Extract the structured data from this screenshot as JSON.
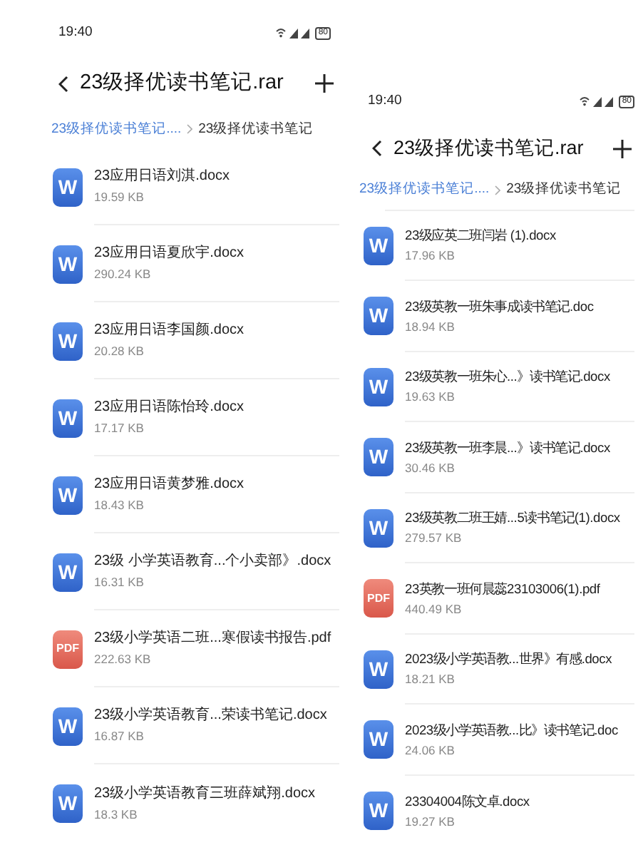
{
  "screens": [
    {
      "status_bar": {
        "time": "19:40",
        "battery": "80"
      },
      "title": "23级择优读书笔记.rar",
      "breadcrumb": [
        {
          "label": "23级择优读书笔记....",
          "selected": false
        },
        {
          "label": "23级择优读书笔记",
          "selected": true
        }
      ],
      "files": [
        {
          "kind": "word",
          "badge": "W",
          "name": "23应用日语刘淇.docx",
          "size": "19.59 KB"
        },
        {
          "kind": "word",
          "badge": "W",
          "name": "23应用日语夏欣宇.docx",
          "size": "290.24 KB"
        },
        {
          "kind": "word",
          "badge": "W",
          "name": "23应用日语李国颜.docx",
          "size": "20.28 KB"
        },
        {
          "kind": "word",
          "badge": "W",
          "name": "23应用日语陈怡玲.docx",
          "size": "17.17 KB"
        },
        {
          "kind": "word",
          "badge": "W",
          "name": "23应用日语黄梦雅.docx",
          "size": "18.43 KB"
        },
        {
          "kind": "word",
          "badge": "W",
          "name": "23级 小学英语教育...个小卖部》.docx",
          "size": "16.31 KB"
        },
        {
          "kind": "pdf",
          "badge": "PDF",
          "name": "23级小学英语二班...寒假读书报告.pdf",
          "size": "222.63 KB"
        },
        {
          "kind": "word",
          "badge": "W",
          "name": "23级小学英语教育...荣读书笔记.docx",
          "size": "16.87 KB"
        },
        {
          "kind": "word",
          "badge": "W",
          "name": "23级小学英语教育三班薛斌翔.docx",
          "size": "18.3 KB"
        }
      ]
    },
    {
      "status_bar": {
        "time": "19:40",
        "battery": "80"
      },
      "title": "23级择优读书笔记.rar",
      "breadcrumb": [
        {
          "label": "23级择优读书笔记....",
          "selected": false
        },
        {
          "label": "23级择优读书笔记",
          "selected": true
        }
      ],
      "files": [
        {
          "kind": "word",
          "badge": "W",
          "name": "23级应英二班闫岩 (1).docx",
          "size": "17.96 KB"
        },
        {
          "kind": "word",
          "badge": "W",
          "name": "23级英教一班朱事成读书笔记.doc",
          "size": "18.94 KB"
        },
        {
          "kind": "word",
          "badge": "W",
          "name": "23级英教一班朱心...》读书笔记.docx",
          "size": "19.63 KB"
        },
        {
          "kind": "word",
          "badge": "W",
          "name": "23级英教一班李晨...》读书笔记.docx",
          "size": "30.46 KB"
        },
        {
          "kind": "word",
          "badge": "W",
          "name": "23级英教二班王婧...5读书笔记(1).docx",
          "size": "279.57 KB"
        },
        {
          "kind": "pdf",
          "badge": "PDF",
          "name": "23英教一班何晨蕊23103006(1).pdf",
          "size": "440.49 KB"
        },
        {
          "kind": "word",
          "badge": "W",
          "name": "2023级小学英语教...世界》有感.docx",
          "size": "18.21 KB"
        },
        {
          "kind": "word",
          "badge": "W",
          "name": "2023级小学英语教...比》读书笔记.doc",
          "size": "24.06 KB"
        },
        {
          "kind": "word",
          "badge": "W",
          "name": "23304004陈文卓.docx",
          "size": "19.27 KB"
        }
      ]
    }
  ]
}
